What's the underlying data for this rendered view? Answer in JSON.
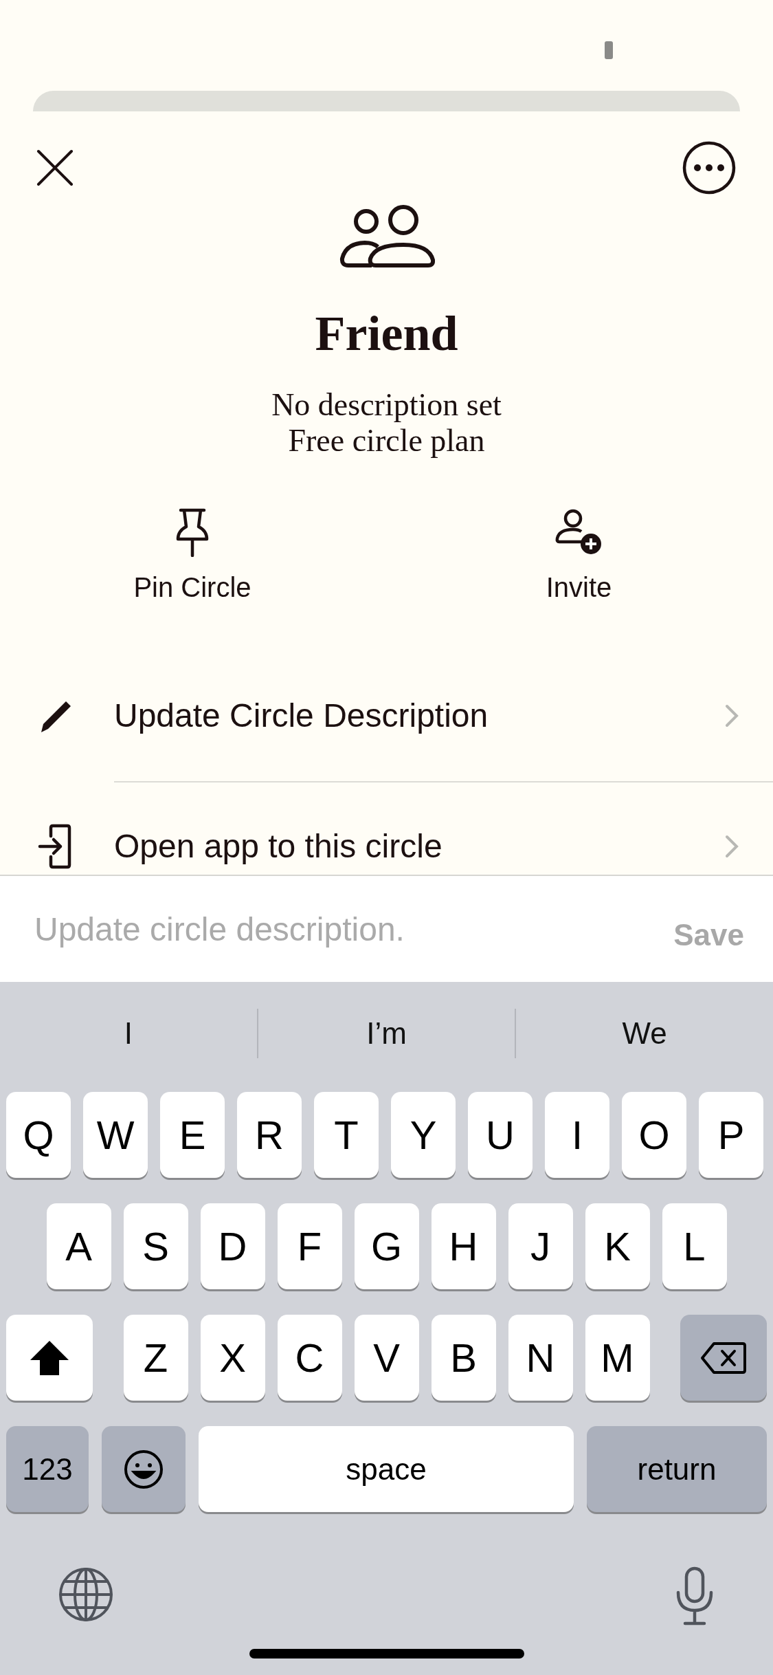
{
  "sheet": {
    "title": "Friend",
    "subtitle_lines": [
      "No description set",
      "Free circle plan"
    ]
  },
  "actions": [
    {
      "label": "Pin Circle",
      "kind": "pin"
    },
    {
      "label": "Invite",
      "kind": "invite"
    }
  ],
  "menu": [
    {
      "label": "Update Circle Description",
      "kind": "edit"
    },
    {
      "label": "Open app to this circle",
      "kind": "open"
    }
  ],
  "composer": {
    "placeholder": "Update circle description.",
    "button": "Save",
    "disabled": true
  },
  "keyboard": {
    "suggestions": [
      "I",
      "I’m",
      "We"
    ],
    "rows": [
      [
        "Q",
        "W",
        "E",
        "R",
        "T",
        "Y",
        "U",
        "I",
        "O",
        "P"
      ],
      [
        "A",
        "S",
        "D",
        "F",
        "G",
        "H",
        "J",
        "K",
        "L"
      ],
      [
        "Z",
        "X",
        "C",
        "V",
        "B",
        "N",
        "M"
      ]
    ],
    "numbers_key": "123",
    "space_key": "space",
    "return_key": "return"
  }
}
